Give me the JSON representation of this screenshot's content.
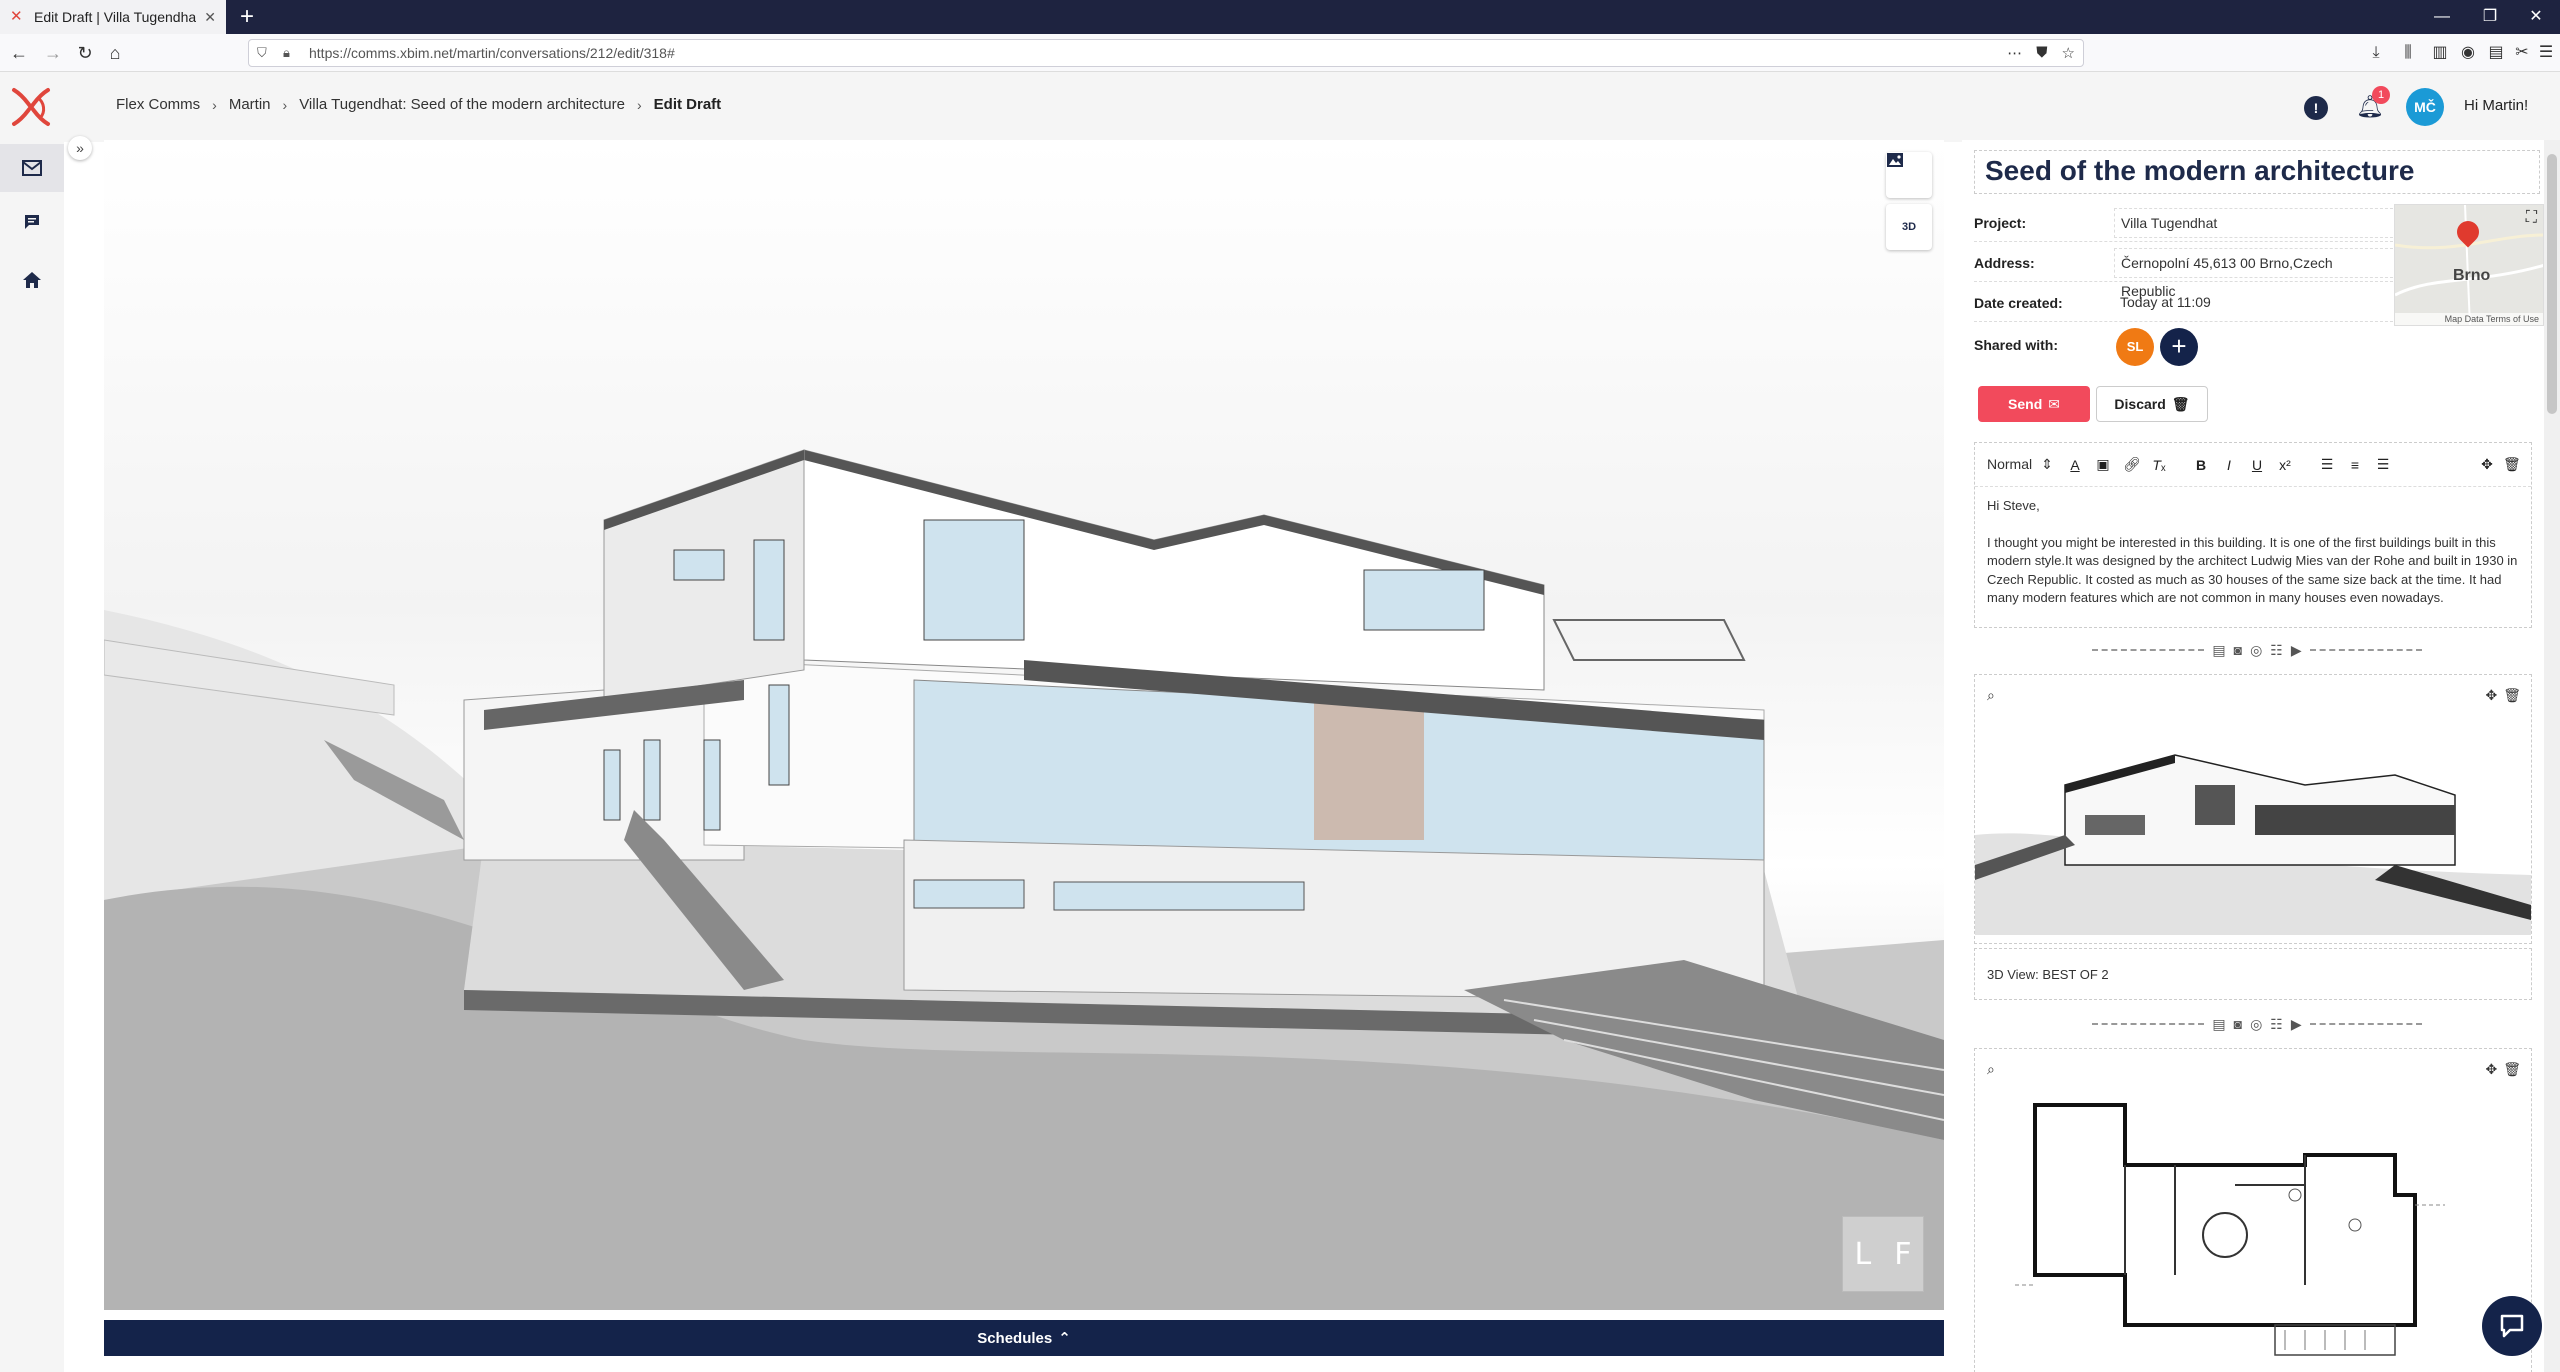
{
  "browser": {
    "tab_title": "Edit Draft | Villa Tugendhat: Se",
    "url": "https://comms.xbim.net/martin/conversations/212/edit/318#"
  },
  "header": {
    "breadcrumb": [
      "Flex Comms",
      "Martin",
      "Villa Tugendhat: Seed of the modern architecture",
      "Edit Draft"
    ],
    "notification_count": "1",
    "user_initials": "MČ",
    "greeting": "Hi Martin!"
  },
  "viewer": {
    "nav_cube_left": "L",
    "nav_cube_right": "F",
    "btn_3d_label": "3D",
    "schedules_label": "Schedules"
  },
  "draft": {
    "title": "Seed of the modern architecture",
    "project_label": "Project:",
    "project_value": "Villa Tugendhat",
    "address_label": "Address:",
    "address_value": "Černopolní 45,613 00 Brno,Czech Republic",
    "date_label": "Date created:",
    "date_value": "Today at 11:09",
    "shared_label": "Shared with:",
    "shared_initials": "SL",
    "map_city": "Brno",
    "map_footer": "Map Data   Terms of Use",
    "send_label": "Send",
    "discard_label": "Discard",
    "format_select": "Normal",
    "greeting_line": "Hi Steve,",
    "body_text": "I thought you might be interested in this building. It is one of the first buildings built in this modern style.It was designed by the architect Ludwig Mies van der Rohe and built in 1930 in Czech Republic. It costed as much as 30 houses of the same size back at the time. It had many modern features which are not common in many houses even nowadays.",
    "image_caption": "3D View: BEST OF 2"
  },
  "colors": {
    "accent_red": "#f24a5c",
    "navy": "#14234a",
    "avatar_blue": "#1b9ad6",
    "avatar_orange": "#f07a14"
  },
  "icons": {
    "rail": [
      "mail-icon",
      "chat-icon",
      "home-icon"
    ],
    "toolbar": [
      "text-color-icon",
      "highlight-icon",
      "link-icon",
      "clear-format-icon",
      "bold-icon",
      "italic-icon",
      "underline-icon",
      "superscript-icon",
      "ordered-list-icon",
      "bullet-list-icon",
      "align-icon"
    ]
  }
}
